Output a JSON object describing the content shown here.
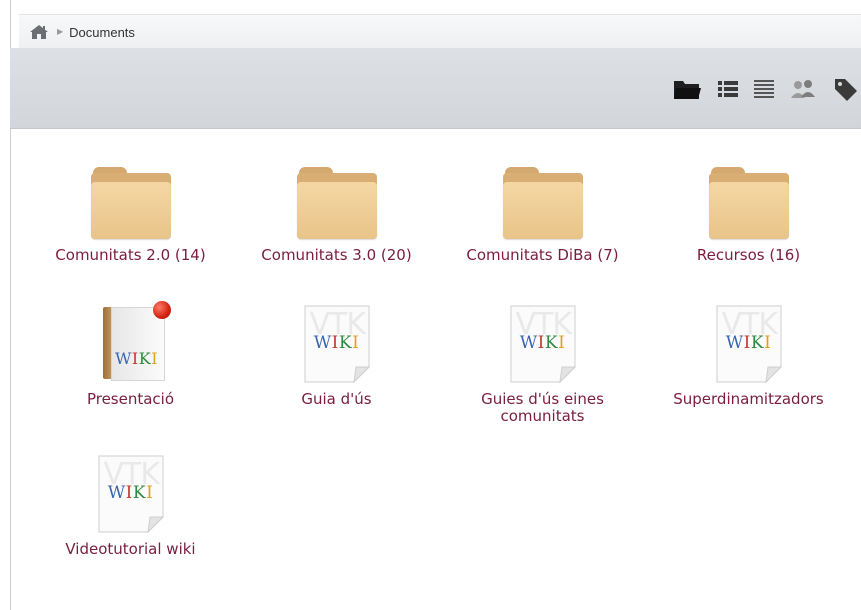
{
  "breadcrumb": {
    "home_icon": "home-icon",
    "current": "Documents"
  },
  "toolbar": {
    "buttons": [
      {
        "name": "folder-view",
        "icon": "folder-icon"
      },
      {
        "name": "list-view",
        "icon": "list-icon"
      },
      {
        "name": "compact-list-view",
        "icon": "compact-list-icon"
      },
      {
        "name": "users-view",
        "icon": "users-icon"
      },
      {
        "name": "tag-view",
        "icon": "tag-icon"
      }
    ]
  },
  "items": [
    {
      "type": "folder",
      "label": "Comunitats 2.0 (14)"
    },
    {
      "type": "folder",
      "label": "Comunitats 3.0 (20)"
    },
    {
      "type": "folder",
      "label": "Comunitats DiBa (7)"
    },
    {
      "type": "folder",
      "label": "Recursos (16)"
    },
    {
      "type": "book",
      "label": "Presentació"
    },
    {
      "type": "wiki",
      "label": "Guia d'ús"
    },
    {
      "type": "wiki",
      "label": "Guies d'ús eines comunitats"
    },
    {
      "type": "wiki",
      "label": "Superdinamitzadors"
    },
    {
      "type": "wiki",
      "label": "Videotutorial wiki"
    }
  ],
  "wiki_icon_text": {
    "w1": "W",
    "w2": "I",
    "w3": "K",
    "w4": "I",
    "bg": "VTK"
  },
  "colors": {
    "label": "#7a1d3f",
    "folder": "#e8c489",
    "toolbar_bg": "#d5d9dd"
  }
}
